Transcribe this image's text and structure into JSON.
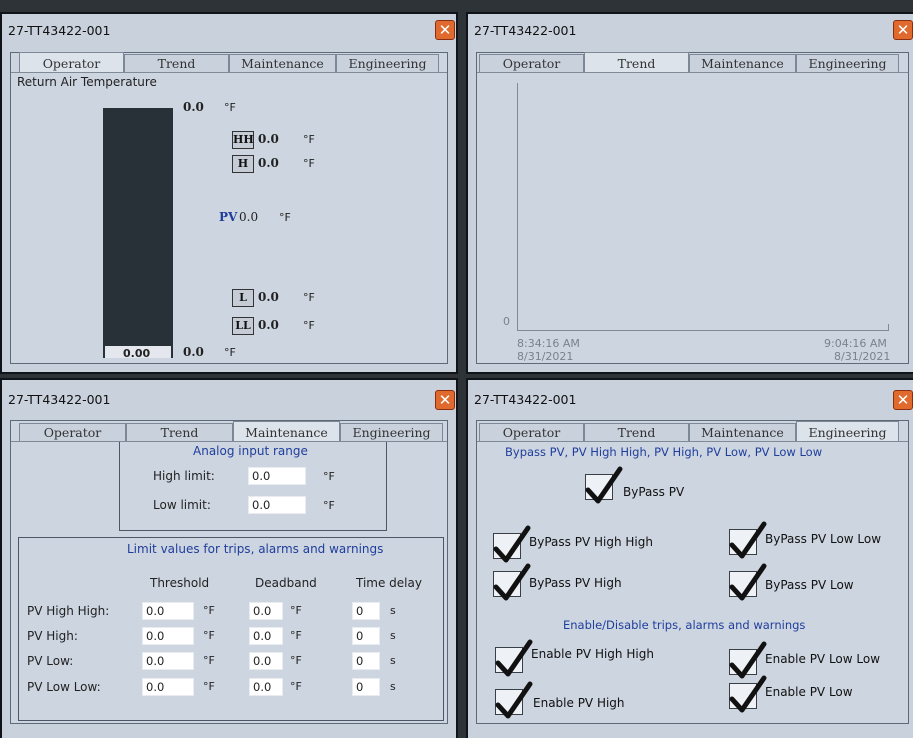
{
  "tag": "27-TT43422-001",
  "close_glyph": "✕",
  "tabs": [
    "Operator",
    "Trend",
    "Maintenance",
    "Engineering"
  ],
  "accent_color": "#1f3e9c",
  "operator": {
    "title": "Return Air Temperature",
    "top_value": "0.0",
    "bottom_value": "0.0",
    "bar_reading": "0.00",
    "unit": "°F",
    "hh": {
      "badge": "HH",
      "value": "0.0"
    },
    "h": {
      "badge": "H",
      "value": "0.0"
    },
    "pv": {
      "label": "PV",
      "value": "0.0"
    },
    "l": {
      "badge": "L",
      "value": "0.0"
    },
    "ll": {
      "badge": "LL",
      "value": "0.0"
    }
  },
  "trend": {
    "y_tick": "0",
    "start_time": "8:34:16 AM",
    "start_date": "8/31/2021",
    "end_time": "9:04:16 AM",
    "end_date": "8/31/2021"
  },
  "maintenance": {
    "range_title": "Analog input range",
    "high_limit_label": "High limit:",
    "high_limit_value": "0.0",
    "low_limit_label": "Low limit:",
    "low_limit_value": "0.0",
    "unit": "°F",
    "limits_title": "Limit values for trips, alarms and warnings",
    "col_threshold": "Threshold",
    "col_deadband": "Deadband",
    "col_delay": "Time delay",
    "sec_unit": "s",
    "rows": [
      {
        "label": "PV High High:",
        "threshold": "0.0",
        "deadband": "0.0",
        "delay": "0"
      },
      {
        "label": "PV High:",
        "threshold": "0.0",
        "deadband": "0.0",
        "delay": "0"
      },
      {
        "label": "PV Low:",
        "threshold": "0.0",
        "deadband": "0.0",
        "delay": "0"
      },
      {
        "label": "PV Low Low:",
        "threshold": "0.0",
        "deadband": "0.0",
        "delay": "0"
      }
    ]
  },
  "engineering": {
    "bypass_title": "Bypass PV, PV High High, PV High, PV Low, PV Low Low",
    "bypass_pv": "ByPass PV",
    "bypass_hh": "ByPass PV High High",
    "bypass_ll": "ByPass PV Low Low",
    "bypass_h": "ByPass PV High",
    "bypass_l": "ByPass PV Low",
    "enable_title": "Enable/Disable trips, alarms and warnings",
    "enable_hh": "Enable PV High High",
    "enable_ll": "Enable PV Low Low",
    "enable_h": "Enable PV High",
    "enable_l": "Enable PV Low"
  }
}
